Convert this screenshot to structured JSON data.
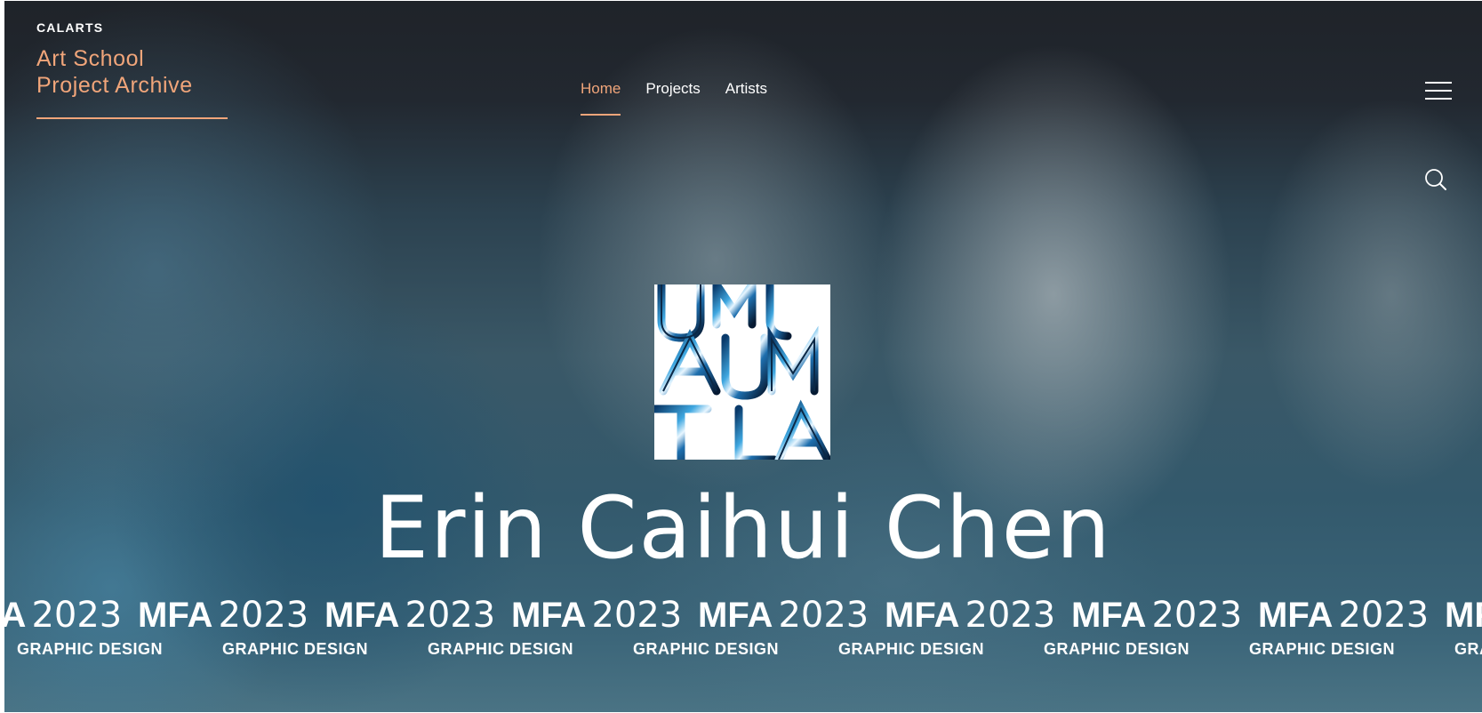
{
  "brand": {
    "kicker": "CALARTS",
    "title_line1": "Art School",
    "title_line2": "Project Archive"
  },
  "nav": [
    {
      "label": "Home",
      "active": true
    },
    {
      "label": "Projects",
      "active": false
    },
    {
      "label": "Artists",
      "active": false
    }
  ],
  "icons": {
    "menu": "hamburger-menu-icon",
    "search": "search-icon"
  },
  "hero": {
    "artist_name": "Erin Caihui Chen",
    "ticker_degree": "MFA",
    "ticker_year": "2023",
    "ticker_program": "GRAPHIC DESIGN"
  },
  "colors": {
    "accent": "#f0a57a",
    "text": "#ffffff",
    "header_bg": "#1f2329"
  }
}
